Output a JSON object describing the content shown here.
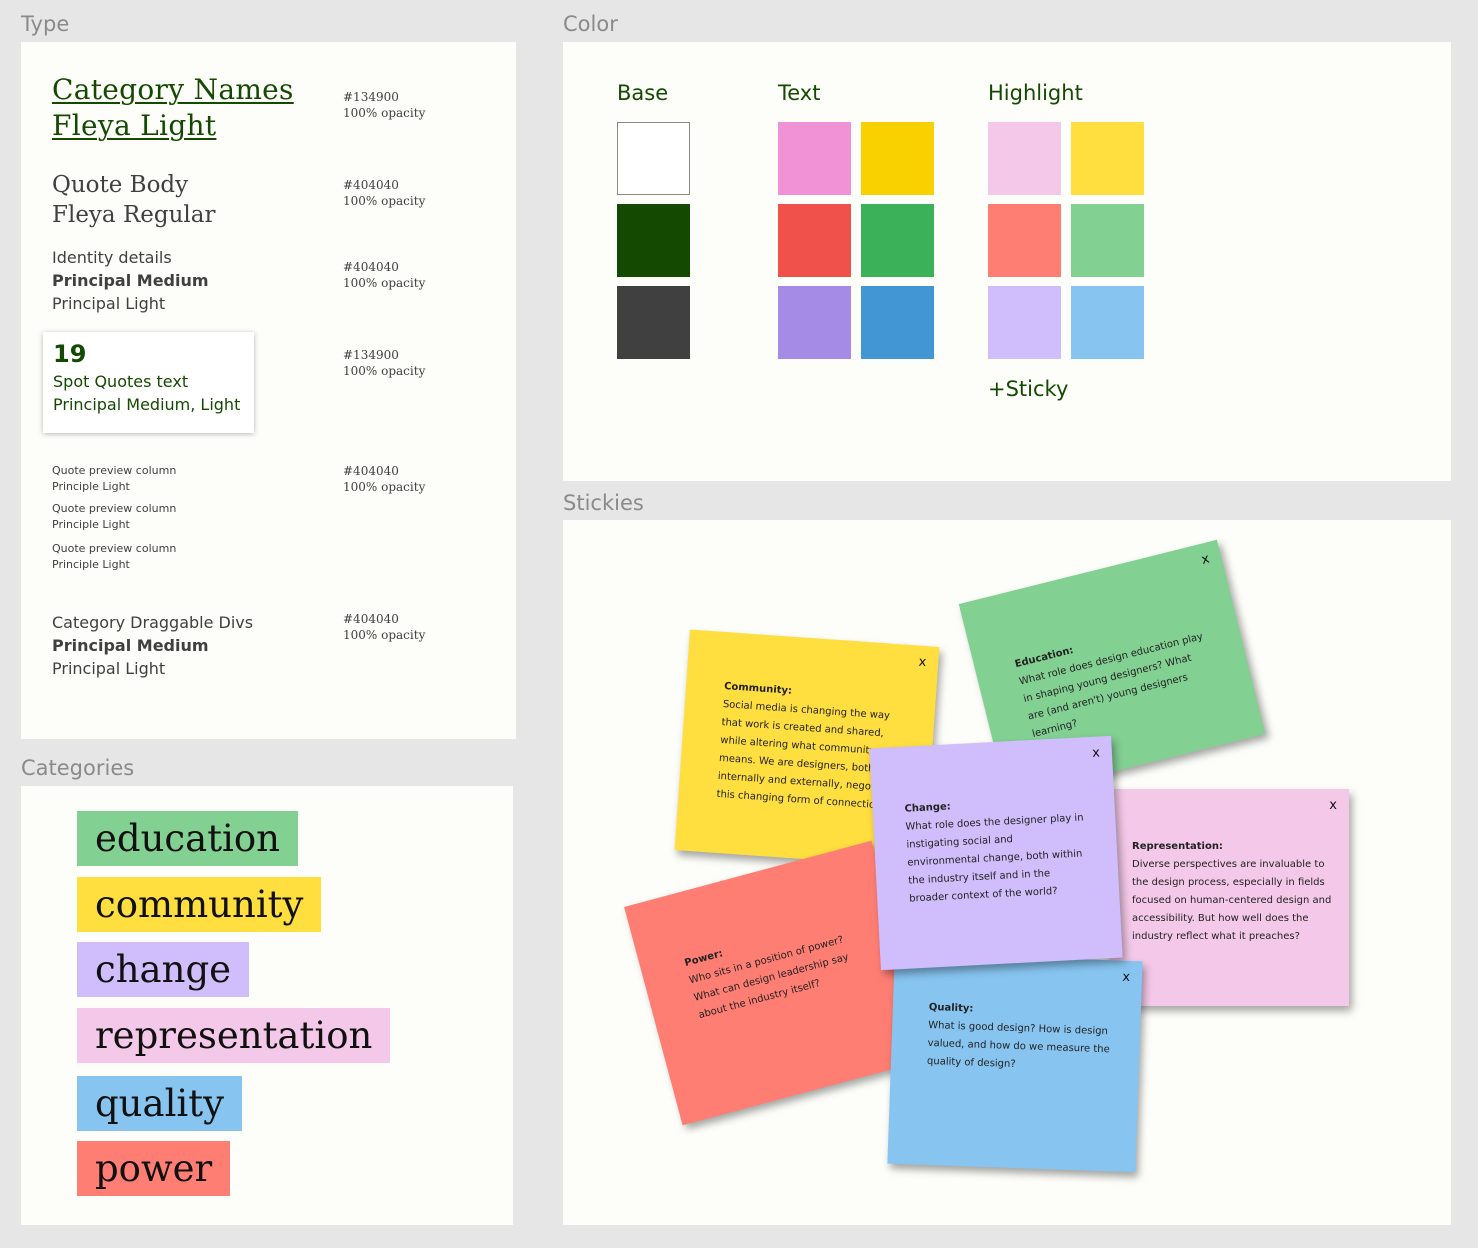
{
  "sections": {
    "type": "Type",
    "color": "Color",
    "categories": "Categories",
    "stickies": "Stickies"
  },
  "type_specs": {
    "category_names": {
      "line1": "Category Names ",
      "line2": "Fleya Light",
      "hex": "#134900",
      "opacity": "100% opacity"
    },
    "quote_body": {
      "line1": "Quote Body",
      "line2": "Fleya Regular",
      "hex": "#404040",
      "opacity": "100% opacity"
    },
    "identity": {
      "line1": "Identity details",
      "line2": "Principal Medium",
      "line3": "Principal Light",
      "hex": "#404040",
      "opacity": "100% opacity"
    },
    "spot": {
      "number": "19",
      "line1": "Spot Quotes text",
      "line2": "Principal Medium, Light",
      "hex": "#134900",
      "opacity": "100% opacity"
    },
    "preview": {
      "items": [
        {
          "line1": "Quote preview column",
          "line2": "Principle Light"
        },
        {
          "line1": "Quote preview column",
          "line2": "Principle Light"
        },
        {
          "line1": "Quote preview column",
          "line2": "Principle Light"
        }
      ],
      "hex": "#404040",
      "opacity": "100% opacity"
    },
    "draggable": {
      "line1": "Category Draggable Divs",
      "line2": "Principal Medium",
      "line3": "Principal Light",
      "hex": "#404040",
      "opacity": "100% opacity"
    }
  },
  "palette": {
    "base_label": "Base",
    "text_label": "Text",
    "highlight_label": "Highlight",
    "plus_sticky": "+Sticky",
    "base": [
      "#ffffff",
      "#134900",
      "#404040"
    ],
    "text": [
      "#f191d6",
      "#f9d000",
      "#f0524b",
      "#3bb25a",
      "#a68be6",
      "#4296d3"
    ],
    "highlight": [
      "#f4c8e8",
      "#ffde3f",
      "#ff7e74",
      "#83d093",
      "#d0bdfb",
      "#87c4f0"
    ]
  },
  "categories": [
    {
      "label": "education",
      "color": "#83d093"
    },
    {
      "label": "community",
      "color": "#ffde3f"
    },
    {
      "label": "change",
      "color": "#d0bdfb"
    },
    {
      "label": "representation",
      "color": "#f4c8e8"
    },
    {
      "label": "quality",
      "color": "#87c4f0"
    },
    {
      "label": "power",
      "color": "#ff7e74"
    }
  ],
  "stickies": {
    "close_label": "x",
    "education": {
      "title": "Education:",
      "text": "What role does design education play in shaping young designers? What are (and aren't) young designers learning?",
      "color": "#83d093"
    },
    "community": {
      "title": "Community:",
      "text": "Social media is changing the way that work is created and shared, while altering what community means. We are designers, both internally and externally, negotiating this changing form of connection?",
      "color": "#ffde3f"
    },
    "change": {
      "title": "Change:",
      "text": "What role does the designer play in instigating social and environmental change, both within the industry itself and in the broader context of the world?",
      "color": "#d0bdfb"
    },
    "representation": {
      "title": "Representation:",
      "text": "Diverse perspectives are invaluable to the design process, especially in fields focused on human-centered design and accessibility. But how well does the industry reflect what it preaches?",
      "color": "#f4c8e8"
    },
    "power": {
      "title": "Power:",
      "text": "Who sits in a position of power? What can design leadership say about the industry itself?",
      "color": "#ff7e74"
    },
    "quality": {
      "title": "Quality:",
      "text": "What is good design? How is design valued, and how do we measure the quality of design?",
      "color": "#87c4f0"
    }
  }
}
